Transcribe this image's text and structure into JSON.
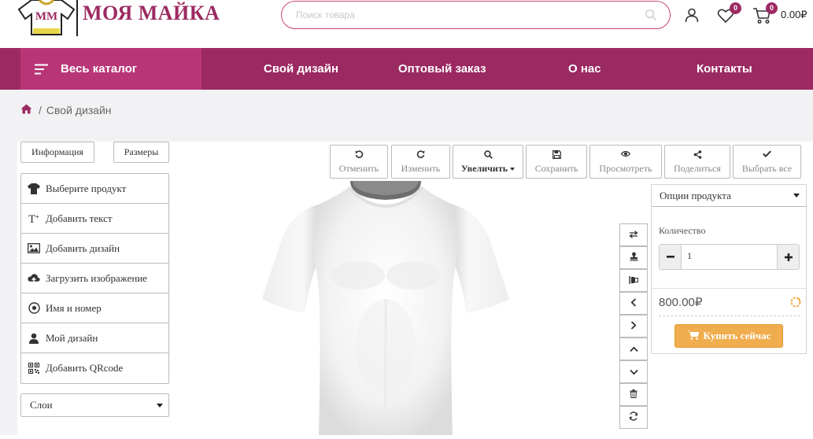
{
  "header": {
    "logo_initials": "MM",
    "logo_text": "МОЯ МАЙКА",
    "search": {
      "placeholder": "Поиск товара",
      "value": ""
    },
    "wishlist_count": "0",
    "cart_count": "0",
    "cart_total": "0.00₽"
  },
  "nav": {
    "catalog_label": "Весь каталог",
    "items": [
      {
        "label": "Свой дизайн"
      },
      {
        "label": "Оптовый заказ"
      },
      {
        "label": "О нас"
      },
      {
        "label": "Контакты"
      }
    ]
  },
  "breadcrumb": {
    "current": "Свой дизайн"
  },
  "designer": {
    "top_buttons": {
      "info": "Информация",
      "sizes": "Размеры"
    },
    "side_items": [
      {
        "label": "Выберите продукт",
        "icon": "tshirt-icon"
      },
      {
        "label": "Добавить текст",
        "icon": "text-icon"
      },
      {
        "label": "Добавить дизайн",
        "icon": "image-icon"
      },
      {
        "label": "Загрузить изображение",
        "icon": "cloud-upload-icon"
      },
      {
        "label": "Имя и номер",
        "icon": "ball-icon"
      },
      {
        "label": "Мой дизайн",
        "icon": "user-icon"
      },
      {
        "label": "Добавить QRcode",
        "icon": "qrcode-icon"
      }
    ],
    "layers_label": "Слои",
    "toolbar": [
      {
        "label": "Отменить",
        "icon": "undo-icon"
      },
      {
        "label": "Изменить",
        "icon": "redo-icon"
      },
      {
        "label": "Увеличить",
        "icon": "zoom-icon"
      },
      {
        "label": "Сохранить",
        "icon": "save-icon"
      },
      {
        "label": "Просмотреть",
        "icon": "eye-icon"
      },
      {
        "label": "Поделиться",
        "icon": "share-icon"
      },
      {
        "label": "Выбрать все",
        "icon": "check-icon"
      }
    ],
    "vertical_tools": [
      "swap-icon",
      "stamp-icon",
      "align-icon",
      "arrow-left-icon",
      "arrow-right-icon",
      "arrow-up-icon",
      "arrow-down-icon",
      "trash-icon",
      "refresh-icon"
    ],
    "options": {
      "header": "Опции продукта",
      "quantity_label": "Количество",
      "quantity_value": "1",
      "price": "800.00₽",
      "buy_label": "Купить сейчас"
    }
  },
  "colors": {
    "brand": "#9c2a62",
    "brand_light": "#b83678",
    "buy_button": "#f0ad4e"
  }
}
